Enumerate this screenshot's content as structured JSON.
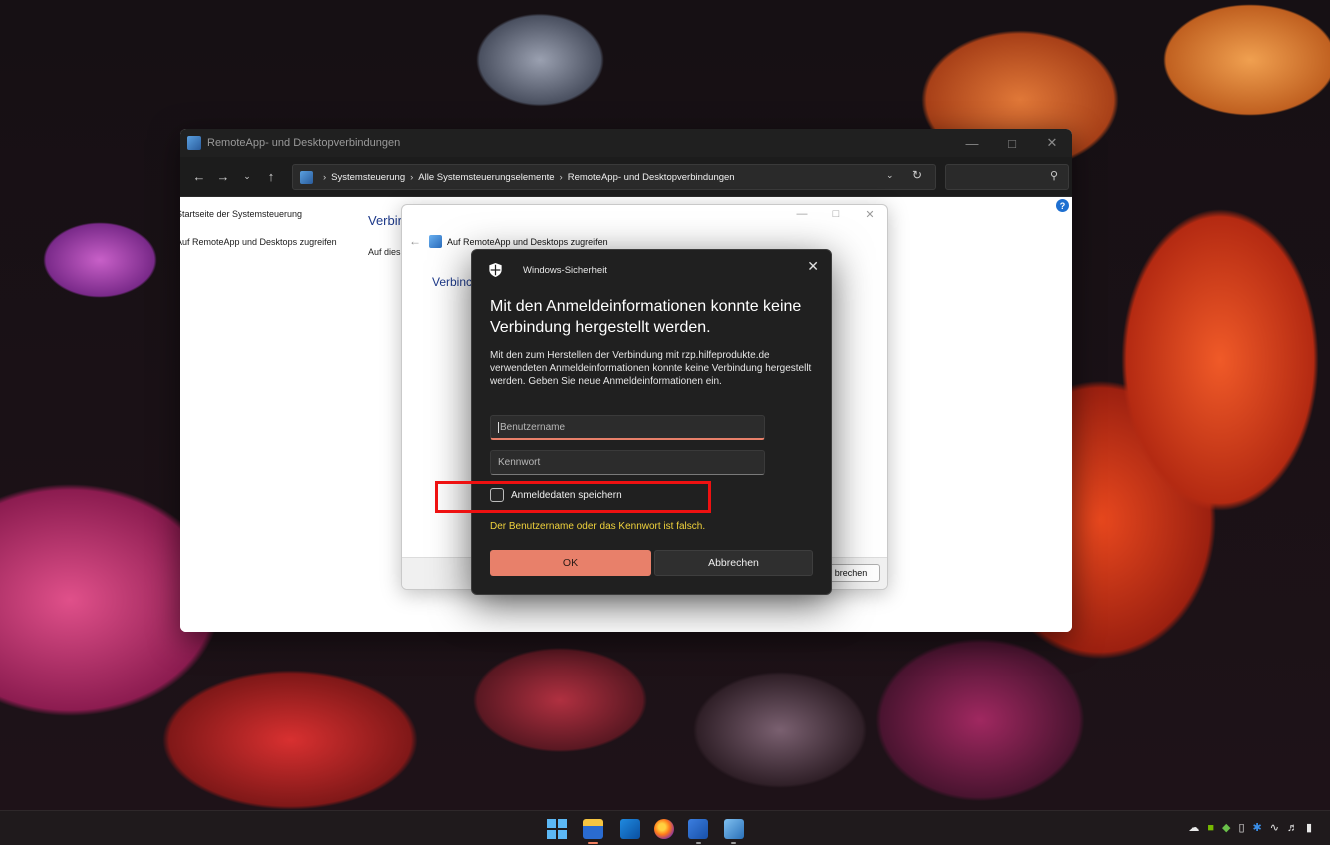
{
  "control_panel": {
    "title": "RemoteApp- und Desktopverbindungen",
    "breadcrumbs": [
      "Systemsteuerung",
      "Alle Systemsteuerungselemente",
      "RemoteApp- und Desktopverbindungen"
    ],
    "side_links": [
      "Startseite der Systemsteuerung",
      "Auf RemoteApp und Desktops zugreifen"
    ],
    "heading": "Verbir",
    "description": "Auf dies",
    "help": "?"
  },
  "wizard": {
    "title": "Auf RemoteApp und Desktops zugreifen",
    "heading": "Verbinc",
    "cancel_label": "brechen"
  },
  "security_dialog": {
    "app_name": "Windows-Sicherheit",
    "heading": "Mit den Anmeldeinformationen konnte keine Verbindung hergestellt werden.",
    "message": "Mit den zum Herstellen der Verbindung mit rzp.hilfeprodukte.de verwendeten Anmeldeinformationen konnte keine Verbindung hergestellt werden. Geben Sie neue Anmeldeinformationen ein.",
    "username_placeholder": "Benutzername",
    "password_placeholder": "Kennwort",
    "remember_label": "Anmeldedaten speichern",
    "remember_checked": false,
    "error": "Der Benutzername oder das Kennwort ist falsch.",
    "ok_label": "OK",
    "cancel_label": "Abbrechen",
    "accent_color": "#e8806a",
    "error_color": "#f0d23c"
  },
  "annotation": {
    "highlight_color": "#ee1111"
  },
  "taskbar": {
    "apps": [
      "windows-start-icon",
      "file-explorer-icon",
      "outlook-icon",
      "firefox-icon",
      "word-icon",
      "remote-desktop-icon"
    ],
    "tray_icons": [
      "onedrive-icon",
      "nvidia-icon",
      "network-app-icon",
      "usb-icon",
      "bluetooth-icon",
      "wifi-icon",
      "volume-icon",
      "battery-icon"
    ]
  }
}
